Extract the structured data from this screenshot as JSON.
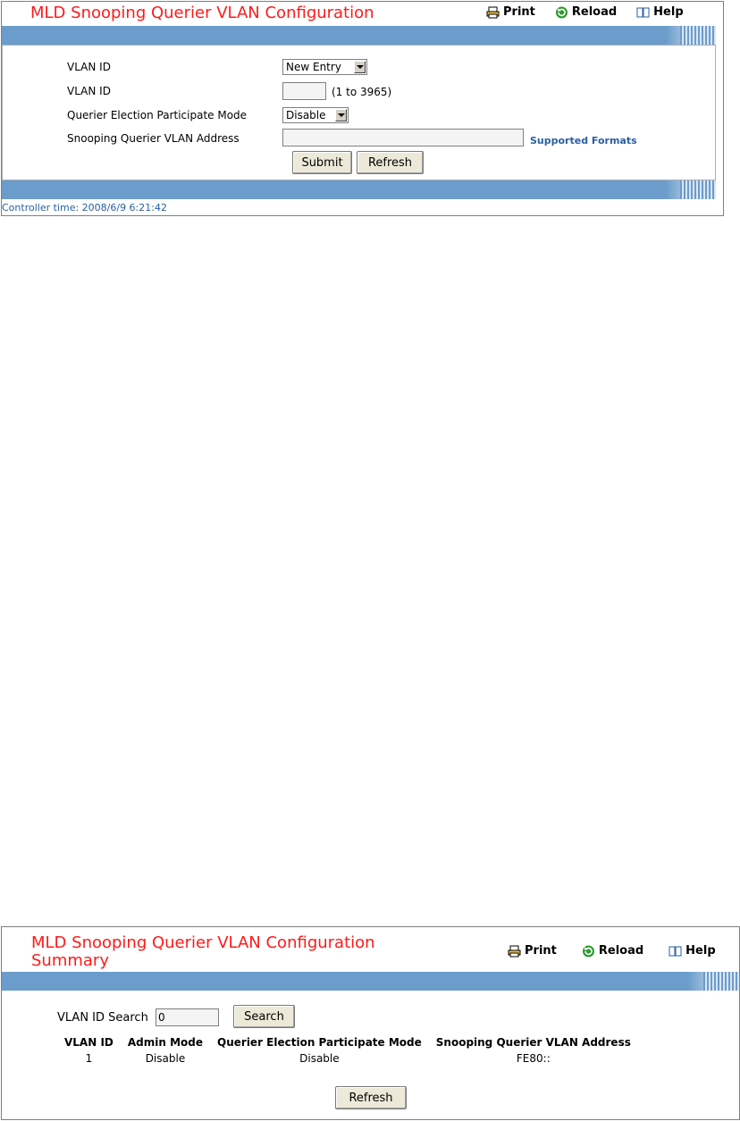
{
  "config": {
    "title": "MLD Snooping Querier VLAN Configuration",
    "toolbar": {
      "print": "Print",
      "reload": "Reload",
      "help": "Help"
    },
    "fields": {
      "vlan_id_select_label": "VLAN ID",
      "vlan_id_select_value": "New Entry",
      "vlan_id_input_label": "VLAN ID",
      "vlan_id_input_value": "",
      "vlan_id_range": "(1 to 3965)",
      "participate_mode_label": "Querier Election Participate Mode",
      "participate_mode_value": "Disable",
      "vlan_address_label": "Snooping Querier VLAN Address",
      "vlan_address_value": "",
      "supported_formats_link": "Supported Formats"
    },
    "buttons": {
      "submit": "Submit",
      "refresh": "Refresh"
    },
    "controller_time": "Controller time: 2008/6/9 6:21:42"
  },
  "summary": {
    "title_line1": "MLD Snooping Querier VLAN Configuration",
    "title_line2": "Summary",
    "toolbar": {
      "print": "Print",
      "reload": "Reload",
      "help": "Help"
    },
    "search_label": "VLAN ID Search",
    "search_value": "0",
    "search_button": "Search",
    "columns": [
      "VLAN ID",
      "Admin Mode",
      "Querier Election Participate Mode",
      "Snooping Querier VLAN Address"
    ],
    "rows": [
      [
        "1",
        "Disable",
        "Disable",
        "FE80::"
      ]
    ],
    "refresh_button": "Refresh"
  },
  "icons": {
    "print": "printer-icon",
    "reload": "reload-icon",
    "help": "help-book-icon"
  },
  "colors": {
    "title": "#ff1a1a",
    "bar": "#6b9ccb",
    "link": "#2a5fa0"
  }
}
